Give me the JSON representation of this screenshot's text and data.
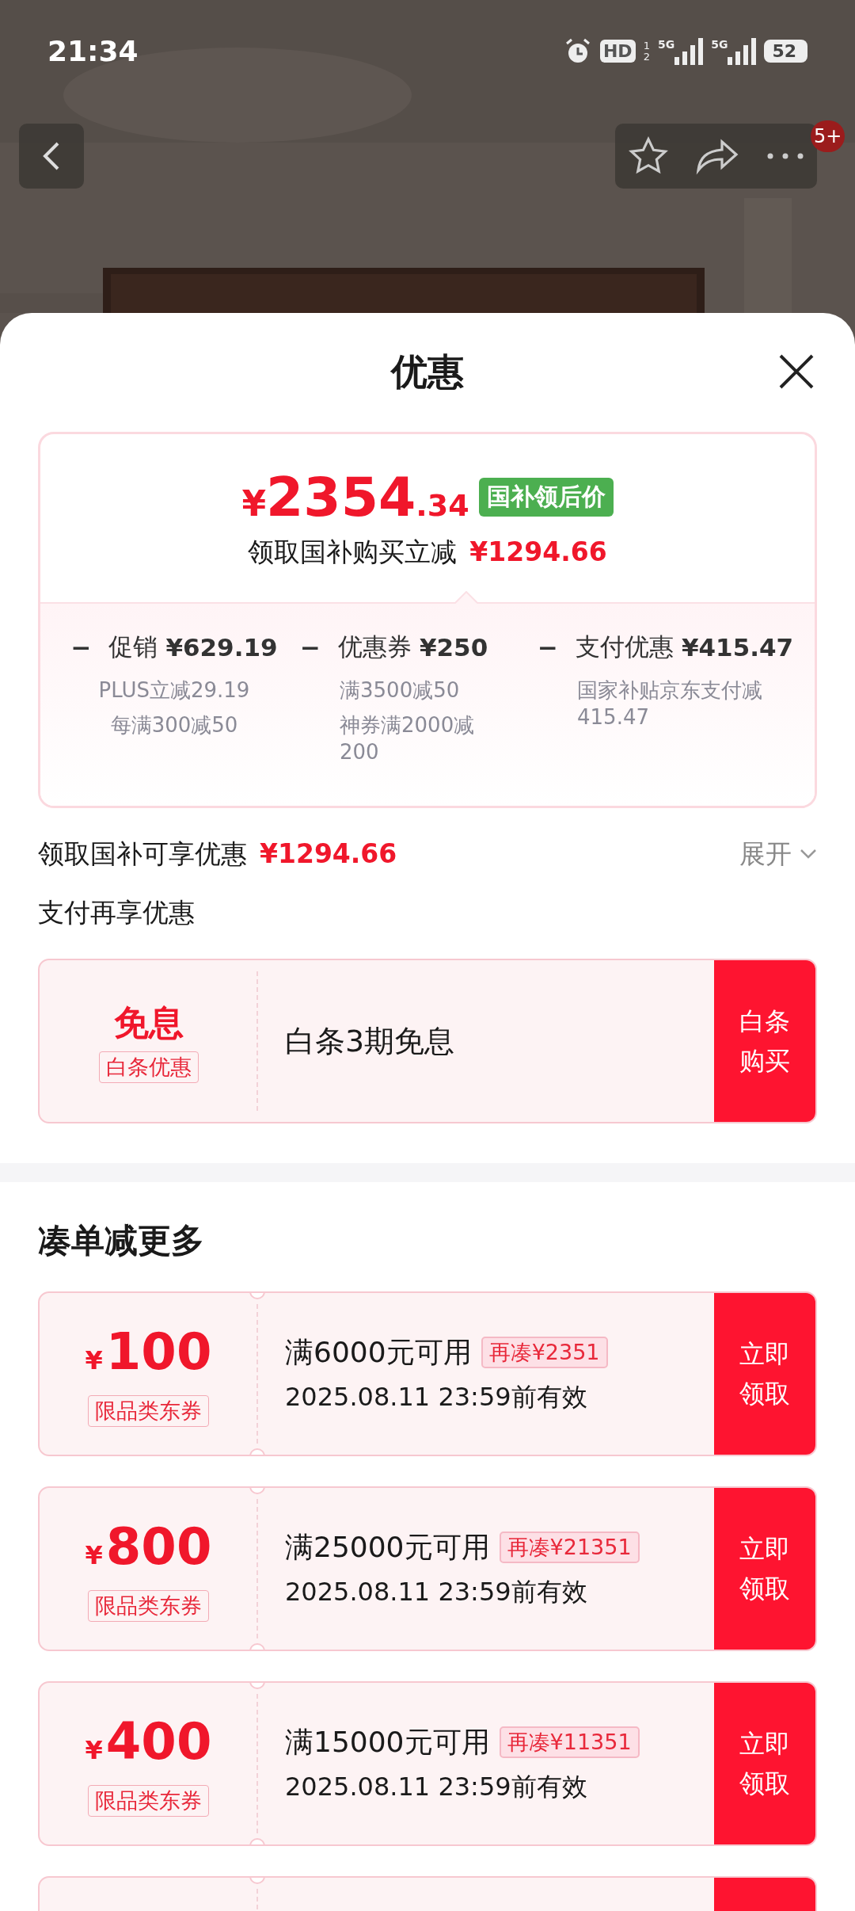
{
  "status_bar": {
    "time": "21:34",
    "hd": "HD",
    "sim_slots": [
      "1",
      "2"
    ],
    "networks": [
      "5G",
      "5G"
    ],
    "battery": "52"
  },
  "nav": {
    "badge": "5+"
  },
  "sheet": {
    "title": "优惠"
  },
  "summary": {
    "currency": "¥",
    "price_main": "2354",
    "price_decimal": ".34",
    "price_tag": "国补领后价",
    "saving_label": "领取国补购买立减",
    "saving_amount": "¥1294.66",
    "breakdown": [
      {
        "sign": "−",
        "label": "促销",
        "amount": "¥629.19",
        "details": [
          "PLUS立减29.19",
          "每满300减50"
        ]
      },
      {
        "sign": "−",
        "label": "优惠券",
        "amount": "¥250",
        "details": [
          "满3500减50",
          "神券满2000减200"
        ]
      },
      {
        "sign": "−",
        "label": "支付优惠",
        "amount": "¥415.47",
        "details": [
          "国家补贴京东支付减415.47"
        ]
      }
    ]
  },
  "discount_row": {
    "label": "领取国补可享优惠",
    "amount": "¥1294.66",
    "toggle": "展开"
  },
  "pay_section": {
    "title": "支付再享优惠",
    "offer": {
      "badge": "免息",
      "tag": "白条优惠",
      "description": "白条3期免息",
      "button": "白条购买"
    }
  },
  "more_section": {
    "title": "凑单减更多",
    "coupons": [
      {
        "currency": "¥",
        "amount": "100",
        "tag": "限品类东券",
        "condition": "满6000元可用",
        "gap": "再凑¥2351",
        "validity": "2025.08.11 23:59前有效",
        "button": "立即领取"
      },
      {
        "currency": "¥",
        "amount": "800",
        "tag": "限品类东券",
        "condition": "满25000元可用",
        "gap": "再凑¥21351",
        "validity": "2025.08.11 23:59前有效",
        "button": "立即领取"
      },
      {
        "currency": "¥",
        "amount": "400",
        "tag": "限品类东券",
        "condition": "满15000元可用",
        "gap": "再凑¥11351",
        "validity": "2025.08.11 23:59前有效",
        "button": "立即领取"
      }
    ],
    "peek_coupon": true
  }
}
